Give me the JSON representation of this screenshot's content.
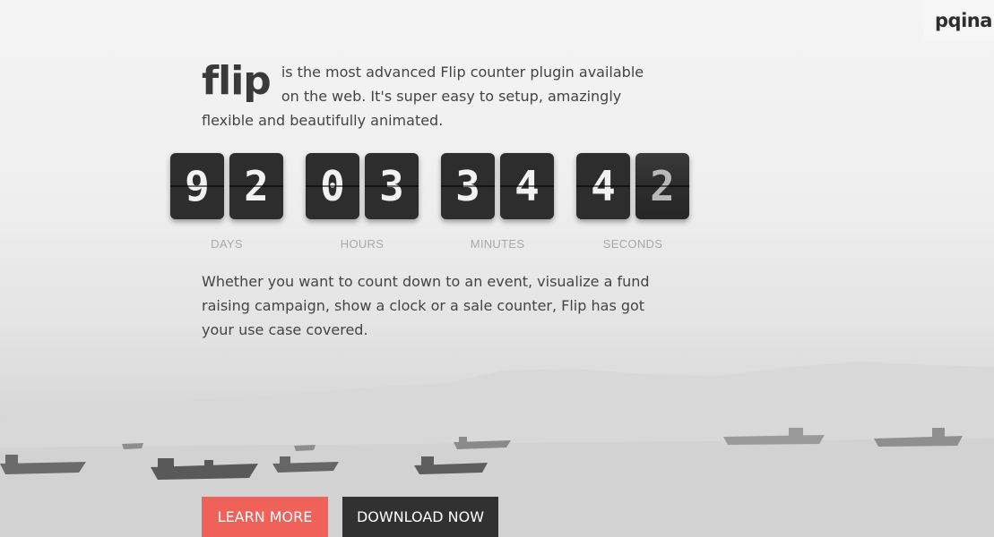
{
  "brand": {
    "name": "pqina"
  },
  "intro": {
    "logo": "flip",
    "text": "is the most advanced Flip counter plugin available on the web. It's super easy to setup, amazingly flexible and beautifully animated."
  },
  "counter": {
    "groups": [
      {
        "label": "DAYS",
        "digits": [
          "9",
          "2"
        ]
      },
      {
        "label": "HOURS",
        "digits": [
          "0",
          "3"
        ]
      },
      {
        "label": "MINUTES",
        "digits": [
          "3",
          "4"
        ]
      },
      {
        "label": "SECONDS",
        "digits": [
          "4",
          "2"
        ]
      }
    ]
  },
  "description": {
    "text": "Whether you want to count down to an event, visualize a fund raising campaign, show a clock or a sale counter, Flip has got your use case covered."
  },
  "actions": {
    "learn_more": "LEARN MORE",
    "download_now": "DOWNLOAD NOW"
  },
  "colors": {
    "accent": "#f0615a",
    "dark_button": "#313131",
    "digit_card": "#2d2d2d",
    "text": "#444444"
  }
}
